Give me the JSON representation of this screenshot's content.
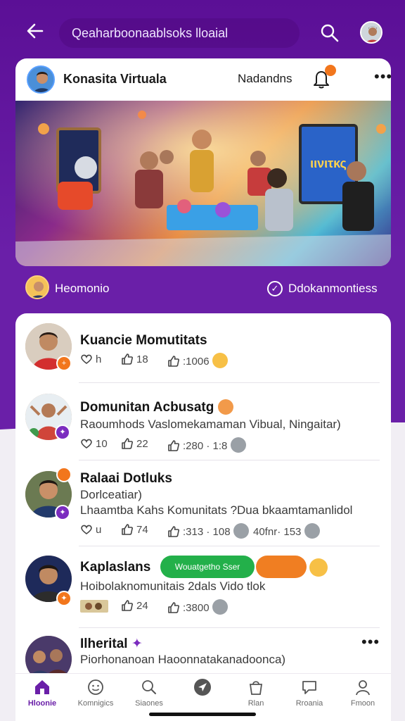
{
  "topbar": {
    "search_text": "Qeaharboonaablsoks lloaial"
  },
  "feature": {
    "title": "Konasita Virtuala",
    "meta": "Nadandns",
    "notif_count": "",
    "footer_left": "Heomonio",
    "footer_right": "Ddokanmontiess"
  },
  "posts": [
    {
      "name": "Kuancie Momutitats",
      "line1": "",
      "line2": "",
      "stats": [
        "h",
        "18",
        ":1006"
      ]
    },
    {
      "name": "Domunitan Acbusatg",
      "line1": "Raoumhods Vaslomekamaman Vibual, Ningaitar)",
      "stats": [
        "10",
        "22",
        ":280 · 1:8"
      ]
    },
    {
      "name": "Ralaai Dotluks",
      "line1": "Dorlceatiar)",
      "line2": "Lhaamtba Kahs Komunitats ?Dua bkaamtamanlidol",
      "stats": [
        "u",
        "74",
        ":313 · 108",
        "40fnr· 153"
      ]
    },
    {
      "name": "Kaplaslans",
      "chip_green": "Wouatgetho Sser",
      "line1": "Hoibolaknomunitais 2dals Vido tlok",
      "stats": [
        "",
        "24",
        ":3800"
      ]
    },
    {
      "name": "Ilherital",
      "line1": "Piorhonanoan Haoonnatakanadoonca)"
    }
  ],
  "nav": [
    {
      "label": "Hloonie",
      "icon": "home-icon",
      "active": true
    },
    {
      "label": "Komnigics",
      "icon": "smile-icon"
    },
    {
      "label": "Siaones",
      "icon": "search-icon"
    },
    {
      "label": "",
      "icon": "compass-icon"
    },
    {
      "label": "Rlan",
      "icon": "bag-icon"
    },
    {
      "label": "Rroania",
      "icon": "chat-icon"
    },
    {
      "label": "Fmoon",
      "icon": "profile-icon"
    }
  ],
  "colors": {
    "brand_purple": "#6a1fa8",
    "accent_orange": "#f2761c",
    "chip_green": "#23b04a"
  }
}
